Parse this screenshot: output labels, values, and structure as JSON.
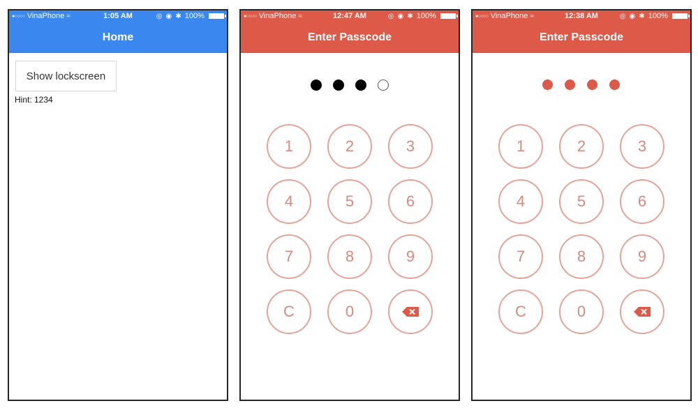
{
  "screens": [
    {
      "status": {
        "carrier": "VinaPhone",
        "time": "1:05 AM",
        "battery": "100%"
      },
      "nav_title": "Home",
      "show_button": "Show lockscreen",
      "hint": "Hint: 1234",
      "nav_color": "#3a87f0"
    },
    {
      "status": {
        "carrier": "VinaPhone",
        "time": "12:47 AM",
        "battery": "100%"
      },
      "nav_title": "Enter Passcode",
      "passcode_filled": 3,
      "passcode_length": 4,
      "keys": [
        "1",
        "2",
        "3",
        "4",
        "5",
        "6",
        "7",
        "8",
        "9",
        "C",
        "0"
      ],
      "nav_color": "#dd5948"
    },
    {
      "status": {
        "carrier": "VinaPhone",
        "time": "12:38 AM",
        "battery": "100%"
      },
      "nav_title": "Enter Passcode",
      "passcode_filled": 4,
      "passcode_length": 4,
      "keys": [
        "1",
        "2",
        "3",
        "4",
        "5",
        "6",
        "7",
        "8",
        "9",
        "C",
        "0"
      ],
      "nav_color": "#dd5948"
    }
  ],
  "icons": {
    "signal": "signal-dots-icon",
    "wifi": "wifi-icon",
    "backspace": "backspace-icon",
    "bluetooth": "bluetooth-icon"
  }
}
